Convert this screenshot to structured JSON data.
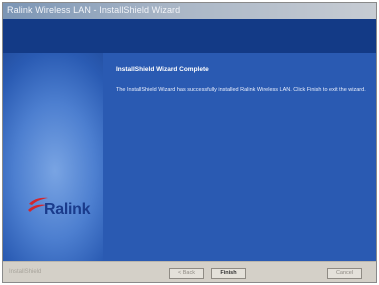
{
  "window": {
    "title": "Ralink Wireless LAN - InstallShield Wizard"
  },
  "side_panel": {
    "logo_text": "Ralink"
  },
  "main": {
    "heading": "InstallShield Wizard Complete",
    "body": "The InstallShield Wizard has successfully installed Ralink Wireless LAN. Click Finish to exit the wizard."
  },
  "footer": {
    "brand": "InstallShield",
    "back_label": "< Back",
    "finish_label": "Finish",
    "cancel_label": "Cancel"
  },
  "colors": {
    "header_band": "#133a86",
    "main_panel": "#2a5ab2",
    "logo_text": "#1a3b8c",
    "logo_swoosh": "#d3262e"
  }
}
